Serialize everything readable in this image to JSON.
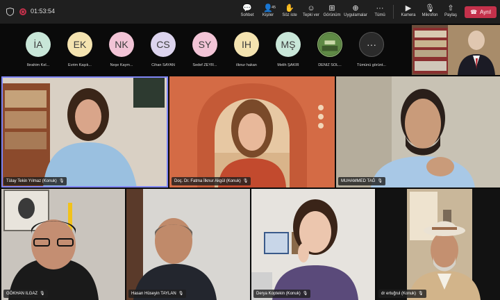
{
  "toolbar": {
    "timer": "01:53:54",
    "chat_label": "Sohbet",
    "people_label": "Kişiler",
    "people_count": "45",
    "raise_label": "Söz iste",
    "react_label": "Tepki ver",
    "view_label": "Görünüm",
    "apps_label": "Uygulamalar",
    "more_label": "Tümü",
    "camera_label": "Kamera",
    "mic_label": "Mikrofon",
    "share_label": "Paylaş",
    "leave_label": "Ayrıl",
    "leave_color": "#c4314b"
  },
  "participants_strip": [
    {
      "initials": "İA",
      "name": "İbrahim Kel...",
      "color": "#c8e6d8"
    },
    {
      "initials": "EK",
      "name": "Evrim Kaşık...",
      "color": "#f4e3b0"
    },
    {
      "initials": "NK",
      "name": "Neşe Kaym...",
      "color": "#f2c4d6"
    },
    {
      "initials": "CS",
      "name": "Cihan SAYAN",
      "color": "#dcd4ee"
    },
    {
      "initials": "SY",
      "name": "Sedef ZEYR...",
      "color": "#f2c4d6"
    },
    {
      "initials": "IH",
      "name": "ilknur hakan",
      "color": "#f4e3b0"
    },
    {
      "initials": "MŞ",
      "name": "Melih ŞAKİR",
      "color": "#c8e6d8"
    },
    {
      "initials": "",
      "name": "DENİZ SOL...",
      "color": "#4a6a3a"
    }
  ],
  "show_all_label": "Tümünü görünt...",
  "video_tiles": [
    {
      "name": "Tülay Tekin Yılmaz (Konuk)"
    },
    {
      "name": "Doç. Dr. Fatma İlknur Akgül (Konuk)"
    },
    {
      "name": "MUHAMMED TAĞ"
    },
    {
      "name": "GÖKHAN ILGAZ"
    },
    {
      "name": "Hasan Hüseyin TAYLAN"
    },
    {
      "name": "Derya Koptekin (Konuk)"
    },
    {
      "name": "dr ertuğrul (Konuk)"
    }
  ],
  "accent_color": "#7f85f5"
}
